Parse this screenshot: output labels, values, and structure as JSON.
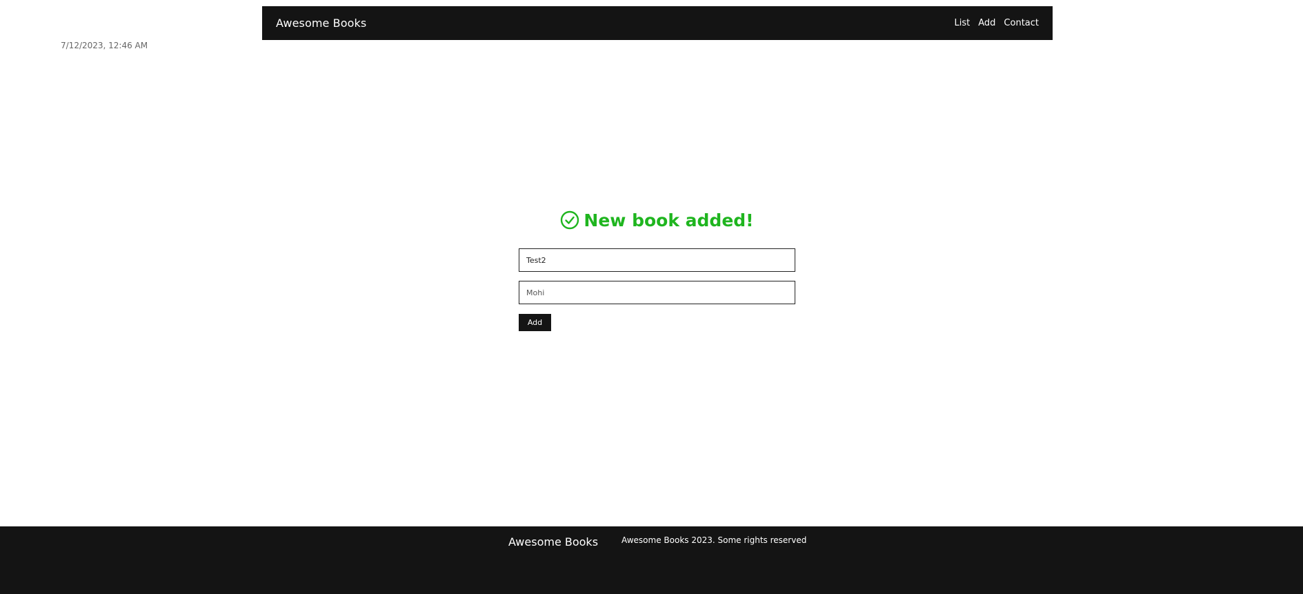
{
  "header": {
    "brand": "Awesome Books",
    "nav": [
      {
        "label": "List"
      },
      {
        "label": "Add"
      },
      {
        "label": "Contact"
      }
    ]
  },
  "datetime": "7/12/2023, 12:46 AM",
  "form": {
    "success_message": "New book added!",
    "success_icon": "check-circle-icon",
    "title_value": "Test2",
    "author_placeholder": "Mohi",
    "add_label": "Add"
  },
  "footer": {
    "brand": "Awesome Books",
    "copyright": "Awesome Books 2023. Some rights reserved"
  },
  "colors": {
    "bar_background": "#141414",
    "success_green": "#1fb51f",
    "page_background": "#ffffff"
  }
}
